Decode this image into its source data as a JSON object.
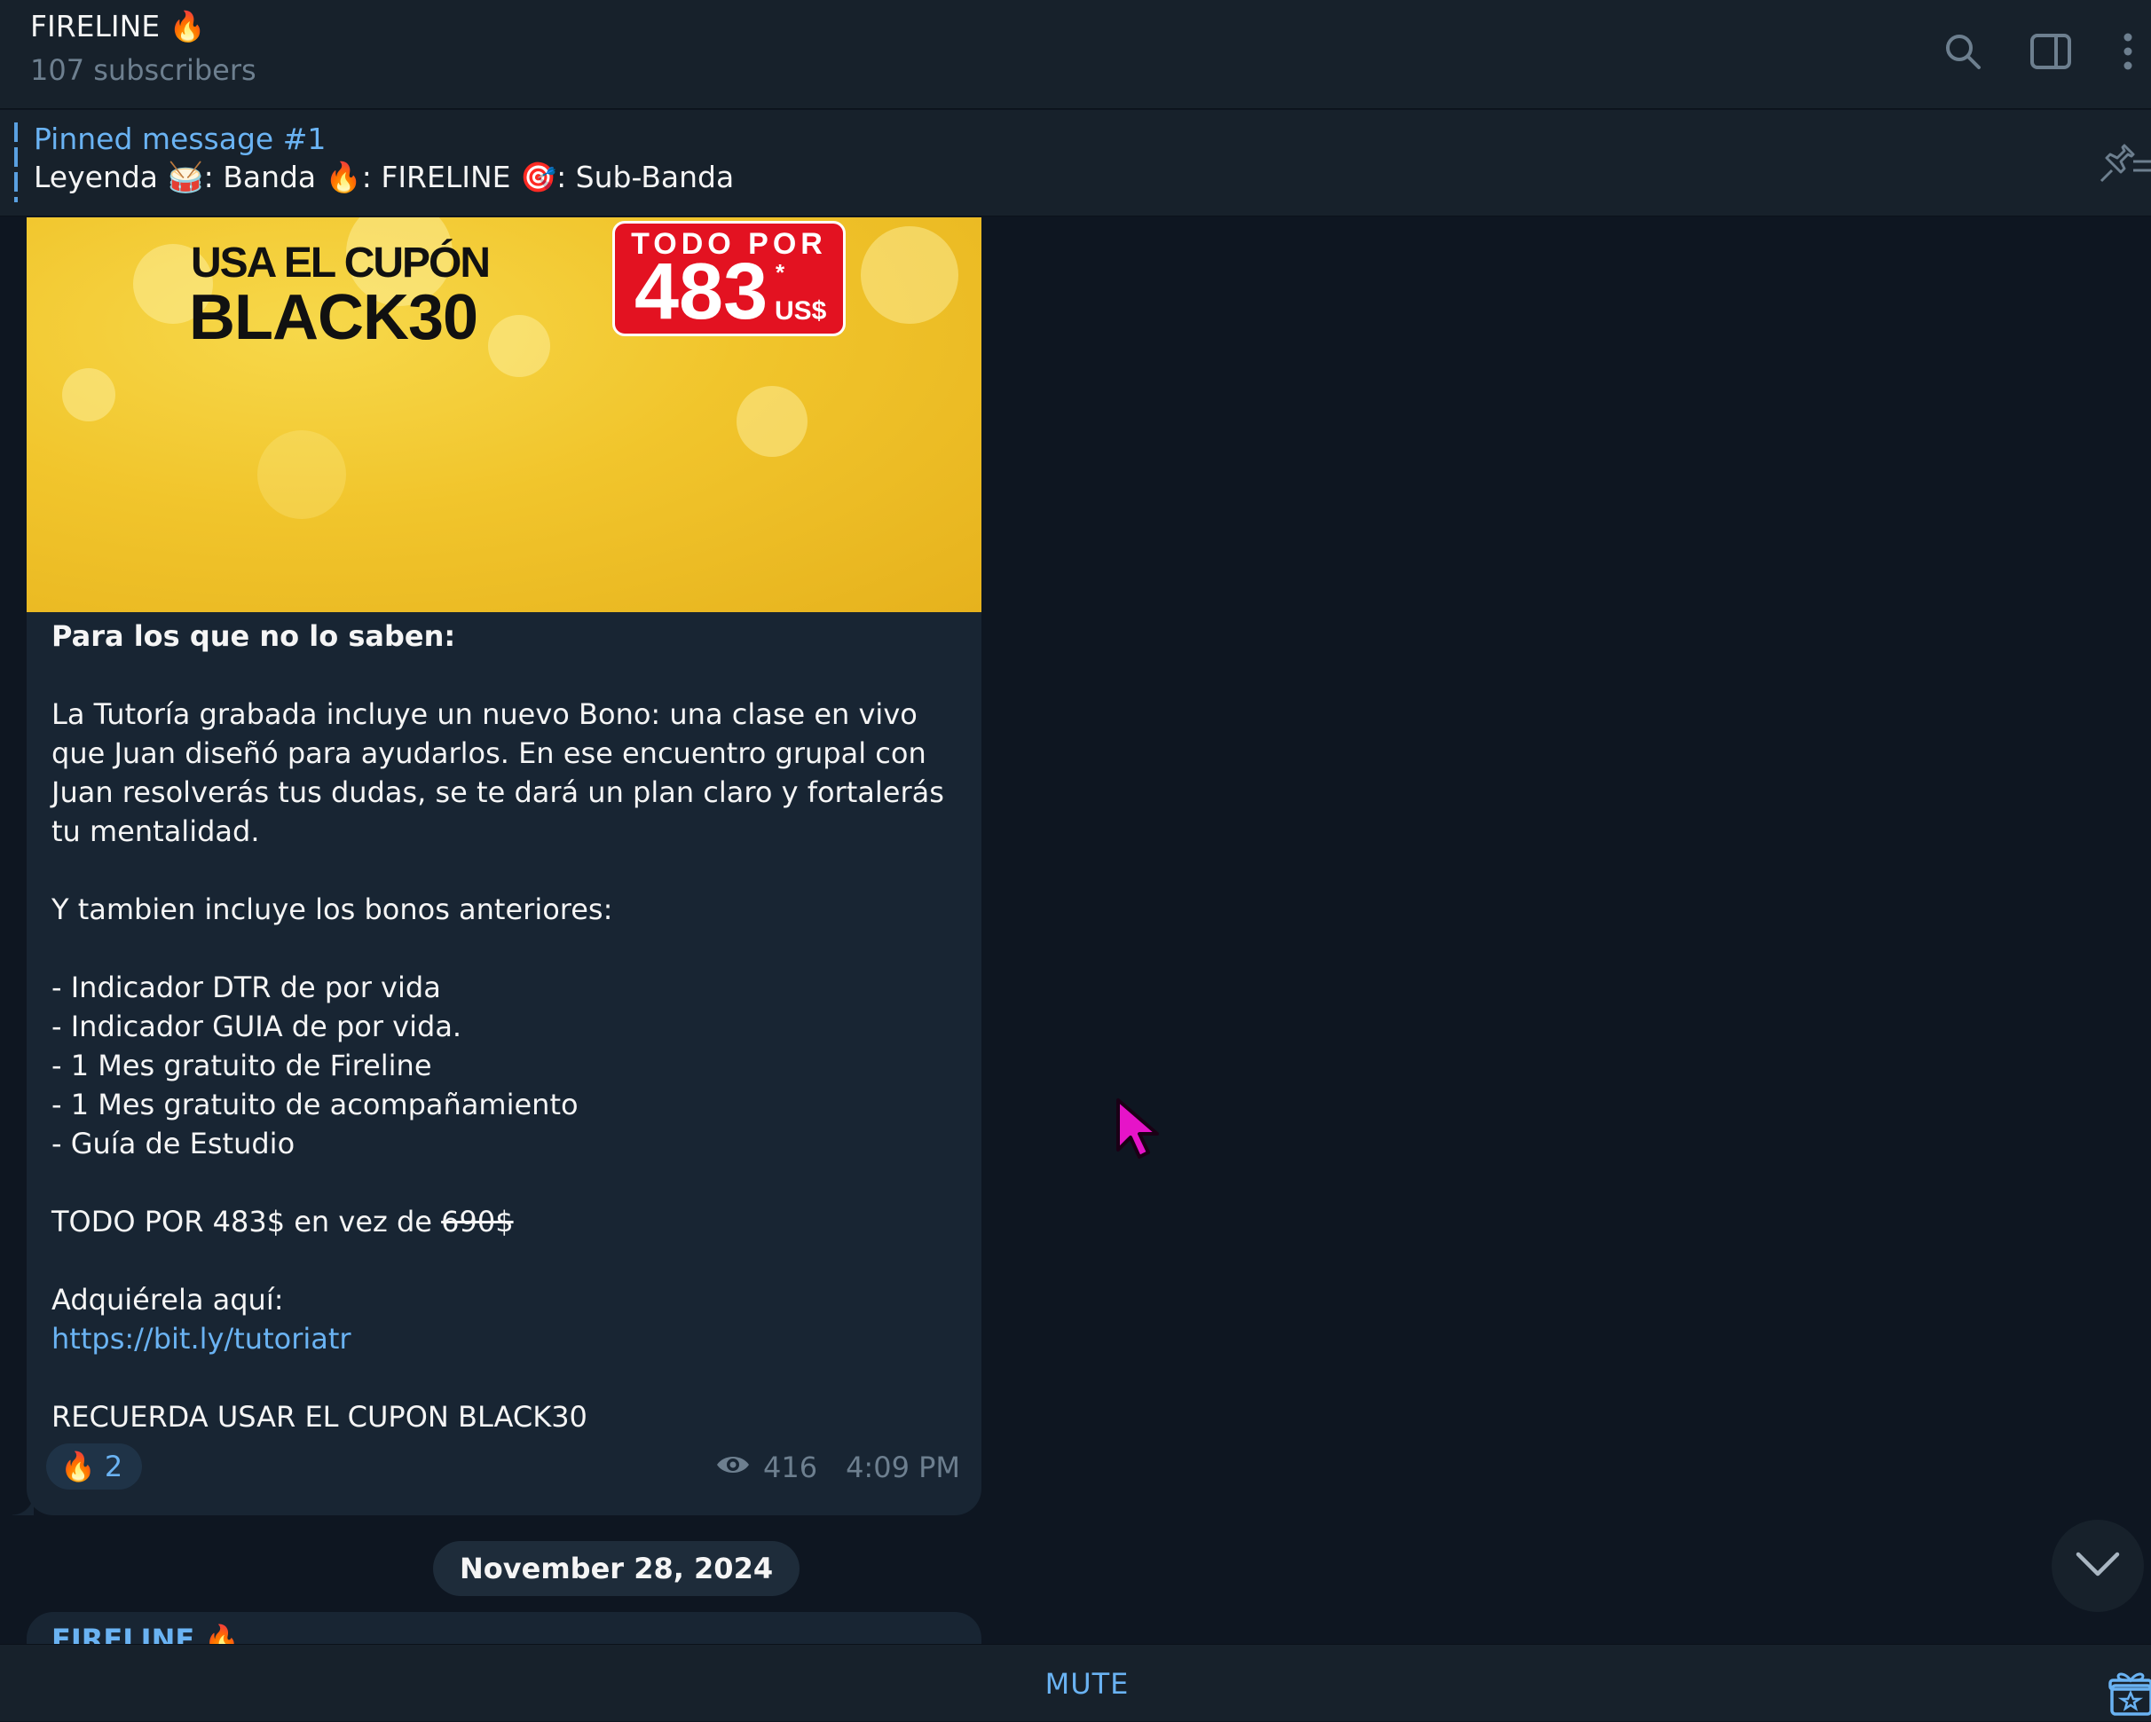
{
  "header": {
    "title": "FIRELINE 🔥",
    "subtitle": "107 subscribers",
    "icons": [
      "search-icon",
      "sidebar-toggle-icon",
      "more-vertical-icon"
    ]
  },
  "pinned": {
    "title": "Pinned message #1",
    "text": "Leyenda 🥁: Banda  🔥: FIRELINE  🎯: Sub-Banda"
  },
  "message": {
    "banner": {
      "coupon_line1": "USA EL CUPÓN",
      "coupon_line2": "BLACK30",
      "price_caption": "TODO POR",
      "price_amount": "483",
      "price_asterisk": "*",
      "price_currency": "US$"
    },
    "heading": "Para los que no lo saben:",
    "paragraph1": "La Tutoría grabada incluye un nuevo Bono: una clase en vivo que Juan diseñó para ayudarlos. En ese encuentro grupal con Juan resolverás tus dudas, se te dará un plan claro y fortalerás tu mentalidad.",
    "paragraph2": "Y tambien incluye los bonos anteriores:",
    "bonuses": [
      "- Indicador DTR de por vida",
      "- Indicador GUIA de por vida.",
      "- 1 Mes gratuito de Fireline",
      "- 1 Mes gratuito de acompañamiento",
      "- Guía de Estudio"
    ],
    "price_line_prefix": "TODO POR 483$ en vez de ",
    "price_line_old": "690$",
    "acquire_label": "Adquiérela aquí:",
    "link": "https://bit.ly/tutoriatr",
    "reminder": "RECUERDA USAR EL CUPON BLACK30",
    "reaction_emoji": "🔥",
    "reaction_count": "2",
    "views": "416",
    "time": "4:09 PM"
  },
  "date_separator": "November 28, 2024",
  "next_message": {
    "sender": "FIRELINE 🔥"
  },
  "bottom_bar": {
    "action_label": "MUTE"
  },
  "colors": {
    "background": "#0e1621",
    "panel": "#17212b",
    "bubble": "#182533",
    "accent": "#6ab3f3",
    "muted_text": "#6d7f8f",
    "price_red": "#e31221",
    "banner_yellow": "#f1c52c"
  }
}
